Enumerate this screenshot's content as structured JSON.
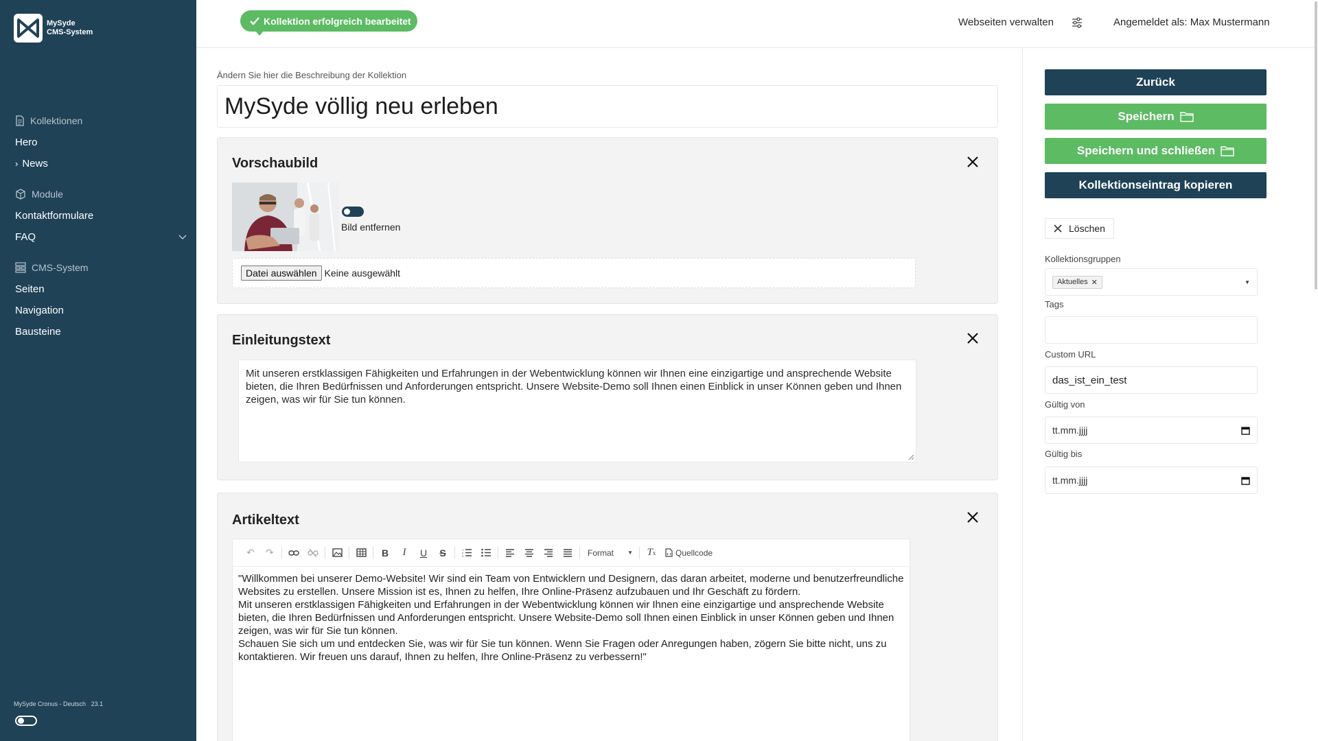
{
  "app": {
    "logo_line1": "MySyde",
    "logo_line2": "CMS-System",
    "footer_version_text": "MySyde Cronus - Deutsch",
    "footer_version_number": "23.1"
  },
  "sidebar": {
    "sections": [
      {
        "header": "Kollektionen",
        "icon": "document-icon",
        "items": [
          "Hero",
          "News"
        ]
      },
      {
        "header": "Module",
        "icon": "cube-icon",
        "items": [
          "Kontaktformulare",
          "FAQ"
        ]
      },
      {
        "header": "CMS-System",
        "icon": "sitemap-icon",
        "items": [
          "Seiten",
          "Navigation",
          "Bausteine"
        ]
      }
    ]
  },
  "topbar": {
    "toast": "Kollektion erfolgreich bearbeitet",
    "manage_sites": "Webseiten verwalten",
    "logged_in_as": "Angemeldet als: Max Mustermann"
  },
  "form": {
    "description_label": "Ändern Sie hier die Beschreibung der Kollektion",
    "title": "MySyde völlig neu erleben",
    "preview": {
      "heading": "Vorschaubild",
      "remove_label": "Bild entfernen",
      "file_button": "Datei auswählen",
      "file_status": "Keine ausgewählt"
    },
    "intro": {
      "heading": "Einleitungstext",
      "text": "Mit unseren erstklassigen Fähigkeiten und Erfahrungen in der Webentwicklung können wir Ihnen eine einzigartige und ansprechende Website bieten, die Ihren Bedürfnissen und Anforderungen entspricht. Unsere Website-Demo soll Ihnen einen Einblick in unser Können geben und Ihnen zeigen, was wir für Sie tun können."
    },
    "article": {
      "heading": "Artikeltext",
      "toolbar_format": "Format",
      "toolbar_source": "Quellcode",
      "paragraphs": [
        "\"Willkommen bei unserer Demo-Website! Wir sind ein Team von Entwicklern und Designern, das daran arbeitet, moderne und benutzerfreundliche Websites zu erstellen. Unsere Mission ist es, Ihnen zu helfen, Ihre Online-Präsenz aufzubauen und Ihr Geschäft zu fördern.",
        "Mit unseren erstklassigen Fähigkeiten und Erfahrungen in der Webentwicklung können wir Ihnen eine einzigartige und ansprechende Website bieten, die Ihren Bedürfnissen und Anforderungen entspricht. Unsere Website-Demo soll Ihnen einen Einblick in unser Können geben und Ihnen zeigen, was wir für Sie tun können.",
        "Schauen Sie sich um und entdecken Sie, was wir für Sie tun können. Wenn Sie Fragen oder Anregungen haben, zögern Sie bitte nicht, uns zu kontaktieren. Wir freuen uns darauf, Ihnen zu helfen, Ihre Online-Präsenz zu verbessern!\""
      ]
    }
  },
  "actions": {
    "back": "Zurück",
    "save": "Speichern",
    "save_close": "Speichern und schließen",
    "copy": "Kollektionseintrag kopieren",
    "delete": "Löschen"
  },
  "meta": {
    "groups_label": "Kollektionsgruppen",
    "group_tag": "Aktuelles",
    "tags_label": "Tags",
    "tags_value": "",
    "custom_url_label": "Custom URL",
    "custom_url_value": "das_ist_ein_test",
    "valid_from_label": "Gültig von",
    "valid_from_value": "tt.mm.jjjj",
    "valid_to_label": "Gültig bis",
    "valid_to_value": "tt.mm.jjjj"
  },
  "colors": {
    "sidebar": "#1f4257",
    "primary_dark": "#1f4257",
    "success_green": "#5cbb63"
  }
}
